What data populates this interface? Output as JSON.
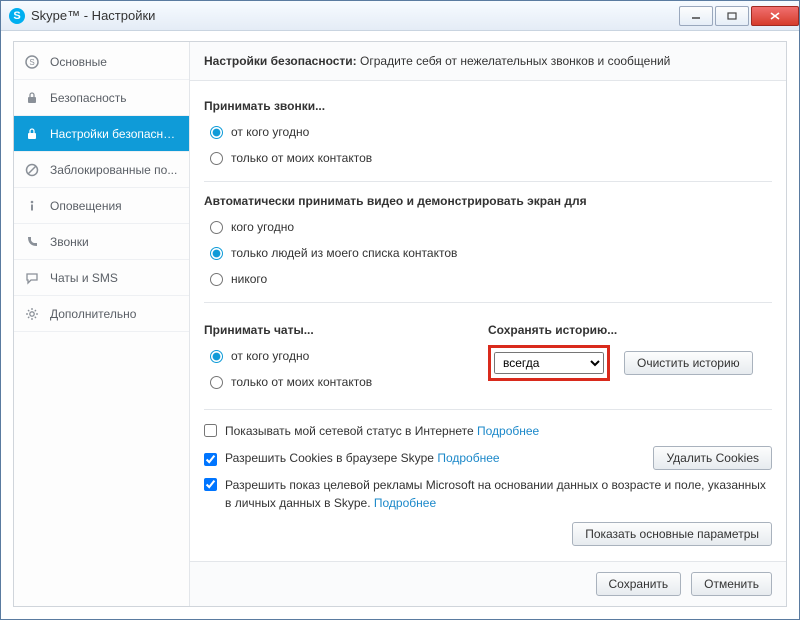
{
  "window": {
    "title": "Skype™ - Настройки"
  },
  "sidebar": {
    "items": [
      {
        "label": "Основные"
      },
      {
        "label": "Безопасность"
      },
      {
        "label": "Настройки безопасно..."
      },
      {
        "label": "Заблокированные по..."
      },
      {
        "label": "Оповещения"
      },
      {
        "label": "Звонки"
      },
      {
        "label": "Чаты и SMS"
      },
      {
        "label": "Дополнительно"
      }
    ]
  },
  "header": {
    "title": "Настройки безопасности:",
    "subtitle": "Оградите себя от нежелательных звонков и сообщений"
  },
  "sections": {
    "calls": {
      "title": "Принимать звонки...",
      "opt1": "от кого угодно",
      "opt2": "только от моих контактов"
    },
    "video": {
      "title": "Автоматически принимать видео и демонстрировать экран для",
      "opt1": "кого угодно",
      "opt2": "только людей из моего списка контактов",
      "opt3": "никого"
    },
    "chats": {
      "title": "Принимать чаты...",
      "opt1": "от кого угодно",
      "opt2": "только от моих контактов"
    },
    "history": {
      "title": "Сохранять историю...",
      "selected": "всегда",
      "clear_btn": "Очистить историю"
    }
  },
  "checks": {
    "status": "Показывать мой сетевой статус в Интернете",
    "cookies": "Разрешить Cookies в браузере Skype",
    "ads_part1": "Разрешить показ целевой рекламы Microsoft на основании данных о возрасте и поле, указанных в личных данных в Skype.",
    "learn_more": "Подробнее",
    "delete_cookies_btn": "Удалить Cookies"
  },
  "buttons": {
    "show_main": "Показать основные параметры",
    "save": "Сохранить",
    "cancel": "Отменить"
  }
}
